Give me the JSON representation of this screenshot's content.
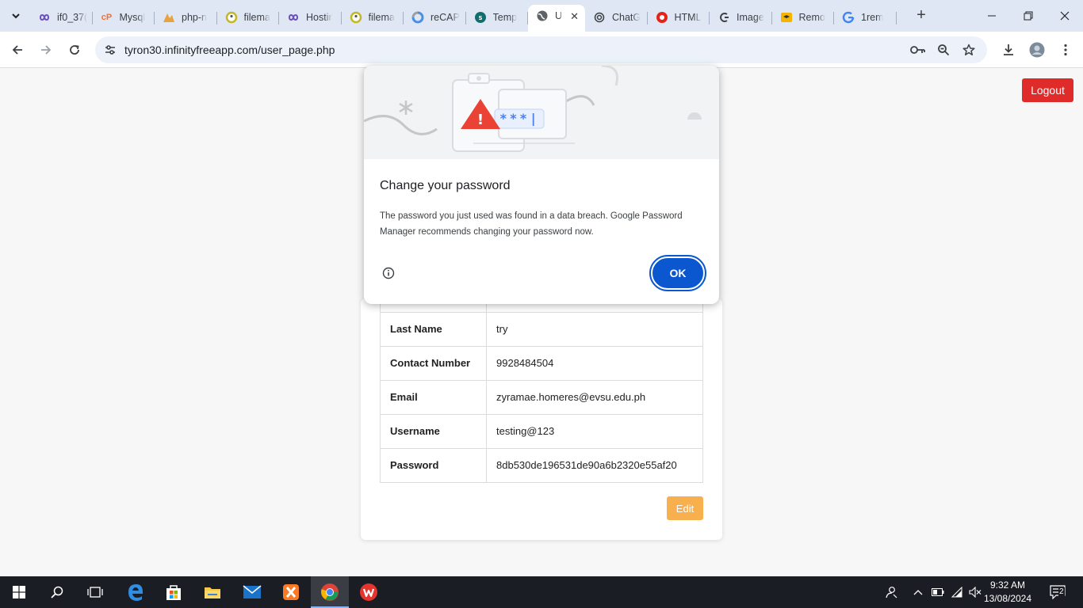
{
  "browser": {
    "tabs": [
      {
        "title": "if0_37(",
        "icon": "infinityfree-icon",
        "color": "#6b4fbb"
      },
      {
        "title": "Mysql",
        "icon": "cpanel-icon",
        "color": "#ff6c2c"
      },
      {
        "title": "php-n",
        "icon": "phpmyadmin-icon",
        "color": "#e8a33d"
      },
      {
        "title": "filema",
        "icon": "filemanager-icon",
        "color": "#c5b624"
      },
      {
        "title": "Hostir",
        "icon": "infinityfree-icon",
        "color": "#6b4fbb"
      },
      {
        "title": "filema",
        "icon": "filemanager-icon",
        "color": "#c5b624"
      },
      {
        "title": "reCAP",
        "icon": "recaptcha-icon",
        "color": "#4a90e2"
      },
      {
        "title": "Temp",
        "icon": "template-icon",
        "color": "#0f6e6e"
      },
      {
        "title": "U",
        "icon": "globe-icon",
        "color": "#3c4043",
        "active": true
      },
      {
        "title": "ChatG",
        "icon": "chatgpt-icon",
        "color": "#3c4043"
      },
      {
        "title": "HTML",
        "icon": "youtube-icon",
        "color": "#e62117"
      },
      {
        "title": "Image",
        "icon": "image-tool-icon",
        "color": "#3c4043"
      },
      {
        "title": "Remo",
        "icon": "remove-icon",
        "color": "#f4b400"
      },
      {
        "title": "1rem",
        "icon": "google-icon",
        "color": "#4285f4"
      }
    ],
    "url": "tyron30.infinityfreeapp.com/user_page.php"
  },
  "page": {
    "logout_label": "Logout",
    "rows": [
      {
        "key": "Last Name",
        "value": "try"
      },
      {
        "key": "Contact Number",
        "value": "9928484504"
      },
      {
        "key": "Email",
        "value": "zyramae.homeres@evsu.edu.ph"
      },
      {
        "key": "Username",
        "value": "testing@123"
      },
      {
        "key": "Password",
        "value": "8db530de196531de90a6b2320e55af20"
      }
    ],
    "edit_label": "Edit"
  },
  "dialog": {
    "title": "Change your password",
    "body": "The password you just used was found in a data breach. Google Password Manager recommends changing your password now.",
    "ok_label": "OK",
    "illustration_text": "***|"
  },
  "taskbar": {
    "time": "9:32 AM",
    "date": "13/08/2024",
    "notification_count": "2"
  },
  "colors": {
    "logout": "#e02b2b",
    "edit": "#f8b04f",
    "ok": "#0b57d0",
    "warning": "#ea4335"
  }
}
